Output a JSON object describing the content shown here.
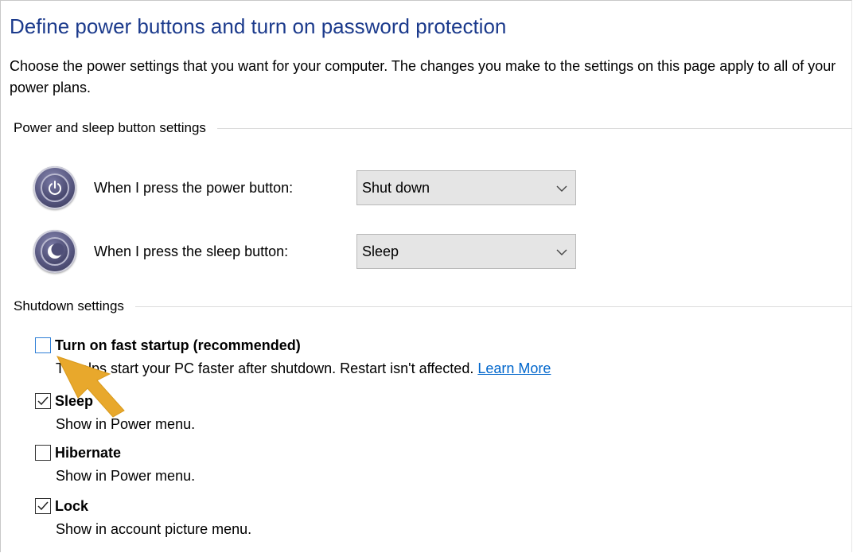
{
  "page": {
    "title": "Define power buttons and turn on password protection",
    "intro": "Choose the power settings that you want for your computer. The changes you make to the settings on this page apply to all of your power plans."
  },
  "power_section": {
    "header": "Power and sleep button settings",
    "rows": [
      {
        "label": "When I press the power button:",
        "value": "Shut down",
        "icon": "power-button-icon"
      },
      {
        "label": "When I press the sleep button:",
        "value": "Sleep",
        "icon": "sleep-button-icon"
      }
    ]
  },
  "shutdown_section": {
    "header": "Shutdown settings",
    "items": [
      {
        "title": "Turn on fast startup (recommended)",
        "checked": false,
        "desc_visible": "elps start your PC faster after shutdown. Restart isn't affected.",
        "desc_prefix": "T",
        "link": "Learn More"
      },
      {
        "title": "Sleep",
        "checked": true,
        "desc": "Show in Power menu."
      },
      {
        "title": "Hibernate",
        "checked": false,
        "desc": "Show in Power menu."
      },
      {
        "title": "Lock",
        "checked": true,
        "desc": "Show in account picture menu."
      }
    ]
  },
  "colors": {
    "title": "#1b3a8c",
    "link": "#0066cc",
    "focus": "#2f7fd6",
    "pointer": "#e8a82c"
  },
  "icons": {
    "dropdown": "chevron-down-icon",
    "check": "checkmark-icon",
    "pointer": "pointer-arrow-icon"
  }
}
